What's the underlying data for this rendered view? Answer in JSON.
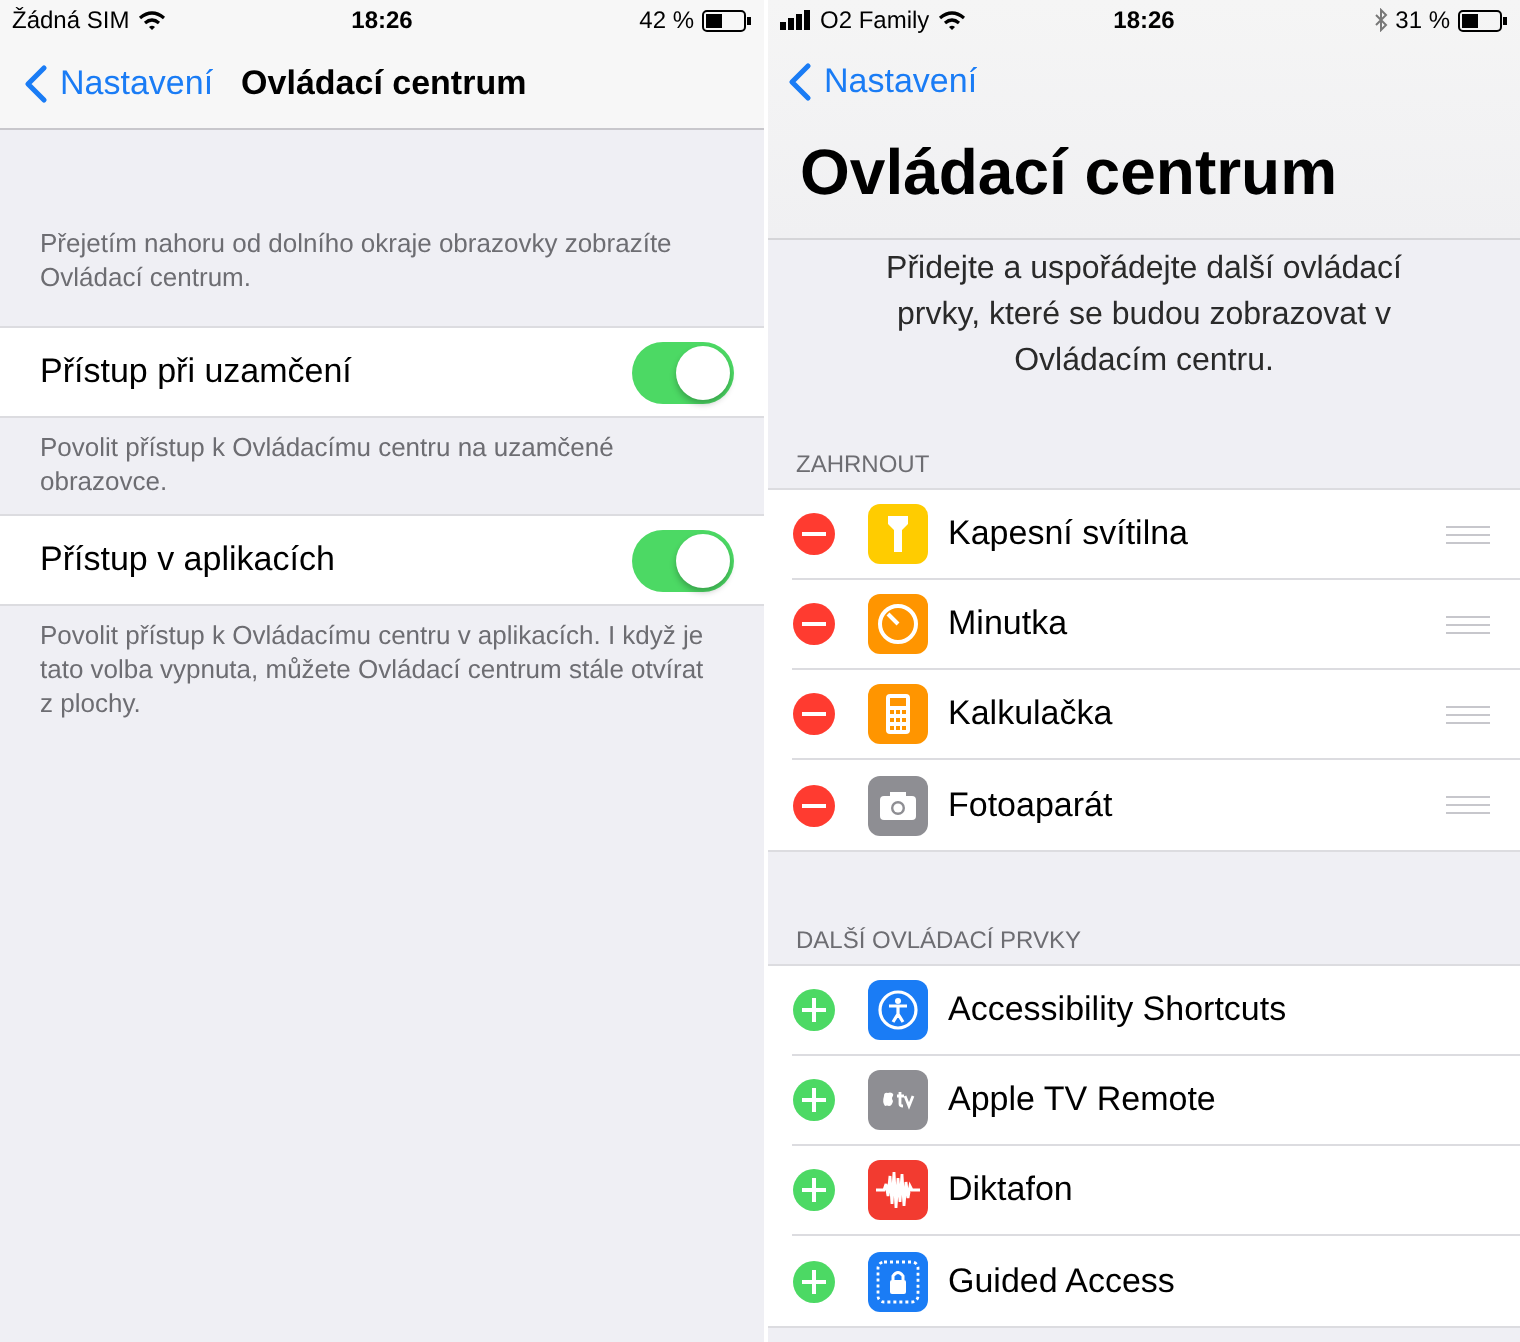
{
  "left": {
    "status_bar": {
      "carrier": "Žádná SIM",
      "time": "18:26",
      "battery": "42 %",
      "bluetooth": false,
      "signal": false
    },
    "nav": {
      "back": "Nastavení",
      "title": "Ovládací centrum"
    },
    "intro": "Přejetím nahoru od dolního okraje obrazovky zobrazíte Ovládací centrum.",
    "settings": [
      {
        "label": "Přístup při uzamčení",
        "on": true,
        "note": "Povolit přístup k Ovládacímu centru na uzamčené obrazovce."
      },
      {
        "label": "Přístup v aplikacích",
        "on": true,
        "note": "Povolit přístup k Ovládacímu centru v aplikacích. I když je tato volba vypnuta, můžete Ovládací centrum stále otvírat z plochy."
      }
    ]
  },
  "right": {
    "status_bar": {
      "carrier": "O2 Family",
      "time": "18:26",
      "battery": "31 %",
      "bluetooth": true,
      "signal": true
    },
    "nav": {
      "back": "Nastavení"
    },
    "title": "Ovládací centrum",
    "description": "Přidejte a uspořádejte další ovládací prvky, které se budou zobrazovat v Ovládacím centru.",
    "sections": [
      {
        "header": "ZAHRNOUT",
        "kind": "remove",
        "items": [
          {
            "label": "Kapesní svítilna",
            "color": "#ffcc00",
            "reorderable": true
          },
          {
            "label": "Minutka",
            "color": "#ff9500",
            "reorderable": true
          },
          {
            "label": "Kalkulačka",
            "color": "#ff9500",
            "reorderable": true
          },
          {
            "label": "Fotoaparát",
            "color": "#8e8e93",
            "reorderable": true
          }
        ]
      },
      {
        "header": "DALŠÍ OVLÁDACÍ PRVKY",
        "kind": "add",
        "items": [
          {
            "label": "Accessibility Shortcuts",
            "color": "#1a7cf5",
            "reorderable": false
          },
          {
            "label": "Apple TV Remote",
            "color": "#8e8e93",
            "reorderable": false
          },
          {
            "label": "Diktafon",
            "color": "#f23b30",
            "reorderable": false
          },
          {
            "label": "Guided Access",
            "color": "#1a7cf5",
            "reorderable": false
          }
        ]
      }
    ]
  }
}
